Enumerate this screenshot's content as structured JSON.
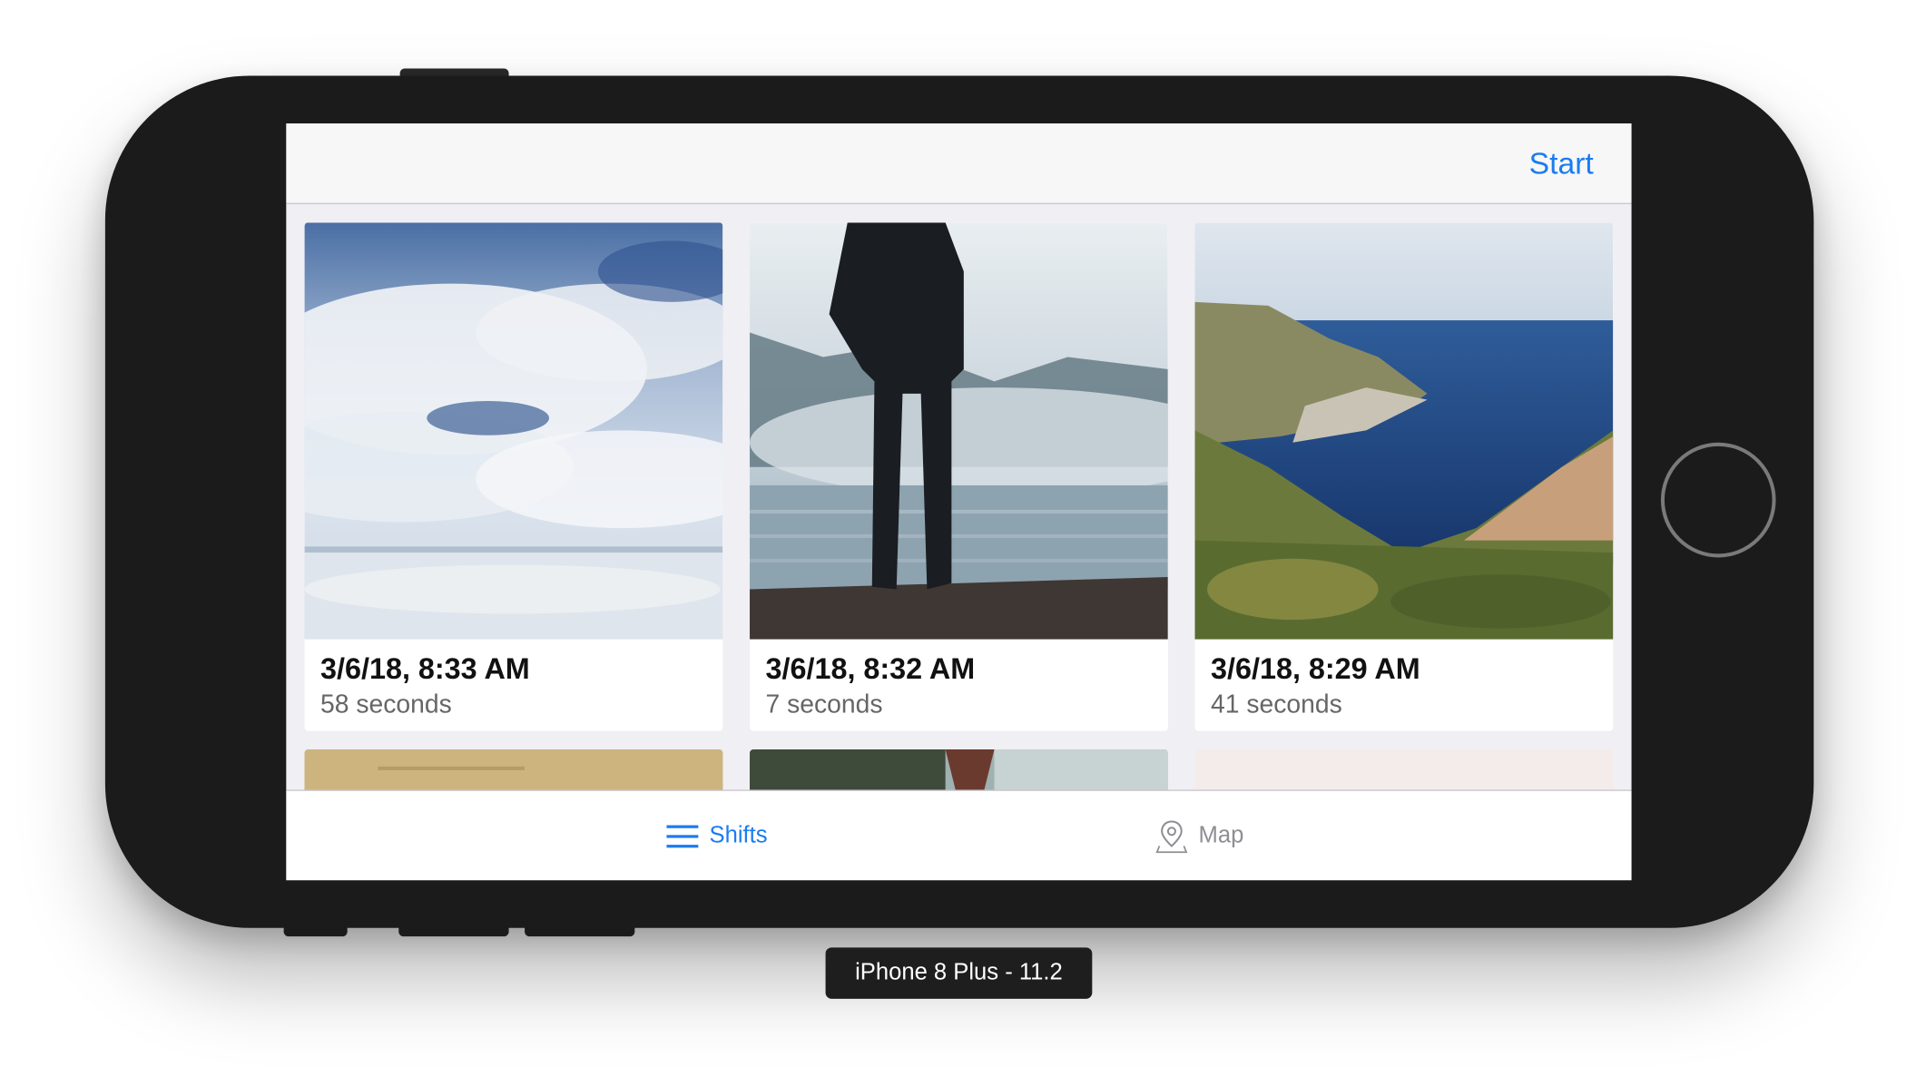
{
  "nav": {
    "start_label": "Start"
  },
  "cards": [
    {
      "date": "3/6/18, 8:33 AM",
      "duration": "58 seconds",
      "photo": "clouds-reflection"
    },
    {
      "date": "3/6/18, 8:32 AM",
      "duration": "7 seconds",
      "photo": "man-on-pier-fog"
    },
    {
      "date": "3/6/18, 8:29 AM",
      "duration": "41 seconds",
      "photo": "coastal-cliffs"
    }
  ],
  "tabs": [
    {
      "label": "Shifts",
      "icon": "list-icon",
      "active": true
    },
    {
      "label": "Map",
      "icon": "map-pin-icon",
      "active": false
    }
  ],
  "colors": {
    "accent": "#1b7cf0",
    "inactive": "#8e8e93"
  },
  "simulator_label": "iPhone 8 Plus - 11.2"
}
